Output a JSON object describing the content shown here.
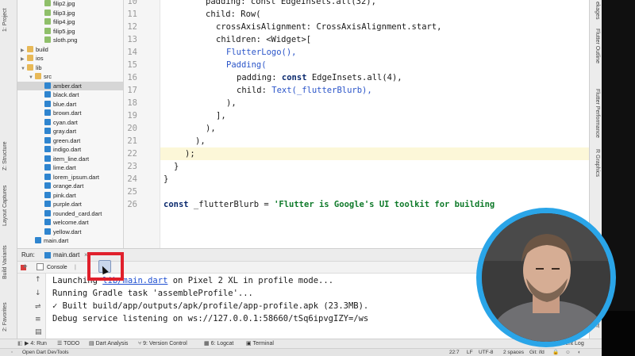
{
  "left_strip": {
    "tabs": [
      "1: Project",
      "Z: Structure",
      "Layout Captures",
      "Build Variants",
      "2: Favorites"
    ]
  },
  "project_tree": {
    "items": [
      {
        "label": "filip2.jpg",
        "icon": "image-file-icon"
      },
      {
        "label": "filip3.jpg",
        "icon": "image-file-icon"
      },
      {
        "label": "filip4.jpg",
        "icon": "image-file-icon"
      },
      {
        "label": "filip5.jpg",
        "icon": "image-file-icon"
      },
      {
        "label": "sloth.png",
        "icon": "image-file-icon"
      },
      {
        "label": "build",
        "icon": "folder-icon"
      },
      {
        "label": "ios",
        "icon": "folder-icon"
      },
      {
        "label": "lib",
        "icon": "folder-icon"
      },
      {
        "label": "src",
        "icon": "folder-icon"
      },
      {
        "label": "amber.dart",
        "icon": "dart-file-icon"
      },
      {
        "label": "black.dart",
        "icon": "dart-file-icon"
      },
      {
        "label": "blue.dart",
        "icon": "dart-file-icon"
      },
      {
        "label": "brown.dart",
        "icon": "dart-file-icon"
      },
      {
        "label": "cyan.dart",
        "icon": "dart-file-icon"
      },
      {
        "label": "gray.dart",
        "icon": "dart-file-icon"
      },
      {
        "label": "green.dart",
        "icon": "dart-file-icon"
      },
      {
        "label": "indigo.dart",
        "icon": "dart-file-icon"
      },
      {
        "label": "item_line.dart",
        "icon": "dart-file-icon"
      },
      {
        "label": "lime.dart",
        "icon": "dart-file-icon"
      },
      {
        "label": "lorem_ipsum.dart",
        "icon": "dart-file-icon"
      },
      {
        "label": "orange.dart",
        "icon": "dart-file-icon"
      },
      {
        "label": "pink.dart",
        "icon": "dart-file-icon"
      },
      {
        "label": "purple.dart",
        "icon": "dart-file-icon"
      },
      {
        "label": "rounded_card.dart",
        "icon": "dart-file-icon"
      },
      {
        "label": "welcome.dart",
        "icon": "dart-file-icon"
      },
      {
        "label": "yellow.dart",
        "icon": "dart-file-icon"
      },
      {
        "label": "main.dart",
        "icon": "dart-file-icon"
      }
    ],
    "selected": "amber.dart"
  },
  "editor": {
    "line_numbers": [
      "10",
      "11",
      "12",
      "13",
      "14",
      "15",
      "16",
      "17",
      "18",
      "19",
      "20",
      "21",
      "22",
      "23",
      "24",
      "25",
      "26"
    ],
    "highlighted_line": "22",
    "code": {
      "l10": "padding: const EdgeInsets.all(32),",
      "l11": "child: Row(",
      "l12_prop": "crossAxisAlignment: ",
      "l12_val": "CrossAxisAlignment.start,",
      "l13": "children: <Widget>[",
      "l14": "FlutterLogo(),",
      "l15": "Padding(",
      "l16_a": "padding: ",
      "l16_b": "const",
      "l16_c": "EdgeInsets.all(4),",
      "l17_a": "child: ",
      "l17_b": "Text(_flutterBlurb),",
      "l18": "),",
      "l19": "],",
      "l20": "),",
      "l21": "),",
      "l22": ");",
      "l23": "}",
      "l24": "}",
      "l26_a": "const",
      "l26_b": " _flutterBlurb = ",
      "l26_c": "'Flutter is Google's UI toolkit for building"
    }
  },
  "right_strip": {
    "tabs": [
      "ekages",
      "Flutter Outline",
      "Flutter Performance",
      "R Graphics",
      "xplorer"
    ]
  },
  "run_panel": {
    "run_label": "Run:",
    "config": "main.dart",
    "console_tab": "Console",
    "console_lines": [
      {
        "pre": "Launching ",
        "link": "lib/main.dart",
        "post": " on Pixel 2 XL in profile mode..."
      },
      {
        "pre": "Running Gradle task 'assembleProfile'...",
        "link": "",
        "post": ""
      },
      {
        "pre": "✓ Built build/app/outputs/apk/profile/app-profile.apk (23.3MB).",
        "link": "",
        "post": ""
      },
      {
        "pre": "Debug service listening on ws://127.0.0.1:58660/tSq6ipvgIZY=/ws",
        "link": "",
        "post": ""
      }
    ]
  },
  "bottom_tabs": {
    "run": "4: Run",
    "todo": "TODO",
    "dart_analysis": "Dart Analysis",
    "version_control": "9: Version Control",
    "logcat": "6: Logcat",
    "terminal": "Terminal",
    "event_log": "Event Log"
  },
  "status_bar": {
    "message": "Open Dart DevTools",
    "position": "22:7",
    "line_sep": "LF",
    "encoding": "UTF-8",
    "indent": "2 spaces",
    "git": "Git: ifd"
  },
  "colors": {
    "highlight_box": "#e0202c",
    "webcam_ring": "#2aa5e8",
    "keyword": "#0b2a6e",
    "class": "#2b55c9",
    "string": "#0f7a2a"
  }
}
